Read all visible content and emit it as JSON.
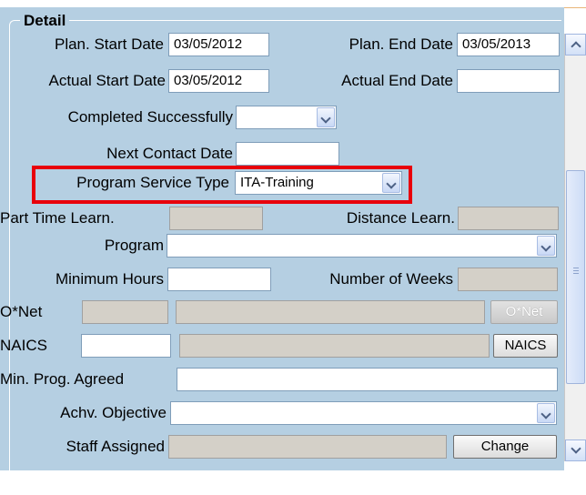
{
  "section_title": "Detail",
  "fields": {
    "plan_start": {
      "label": "Plan. Start Date",
      "value": "03/05/2012"
    },
    "plan_end": {
      "label": "Plan. End Date",
      "value": "03/05/2013"
    },
    "actual_start": {
      "label": "Actual Start Date",
      "value": "03/05/2012"
    },
    "actual_end": {
      "label": "Actual End Date",
      "value": ""
    },
    "completed": {
      "label": "Completed Successfully",
      "value": ""
    },
    "next_contact": {
      "label": "Next Contact Date",
      "value": ""
    },
    "program_service_type": {
      "label": "Program Service Type",
      "value": "ITA-Training"
    },
    "part_time": {
      "label": "Part Time Learn.",
      "value": ""
    },
    "distance": {
      "label": "Distance Learn.",
      "value": ""
    },
    "program": {
      "label": "Program",
      "value": ""
    },
    "min_hours": {
      "label": "Minimum Hours",
      "value": ""
    },
    "num_weeks": {
      "label": "Number of Weeks",
      "value": ""
    },
    "onet": {
      "label": "O*Net",
      "value": "",
      "desc": "",
      "button": "O*Net"
    },
    "naics": {
      "label": "NAICS",
      "value": "",
      "desc": "",
      "button": "NAICS"
    },
    "min_prog_agreed": {
      "label": "Min. Prog. Agreed",
      "value": ""
    },
    "achv_objective": {
      "label": "Achv. Objective",
      "value": ""
    },
    "staff_assigned": {
      "label": "Staff Assigned",
      "value": "",
      "button": "Change"
    }
  },
  "colors": {
    "panel": "#b5cfe2",
    "highlight": "#e8000b"
  },
  "icons": {
    "dropdown": "chevron-down-icon",
    "scroll_up": "chevron-up-icon",
    "scroll_down": "chevron-down-icon"
  }
}
